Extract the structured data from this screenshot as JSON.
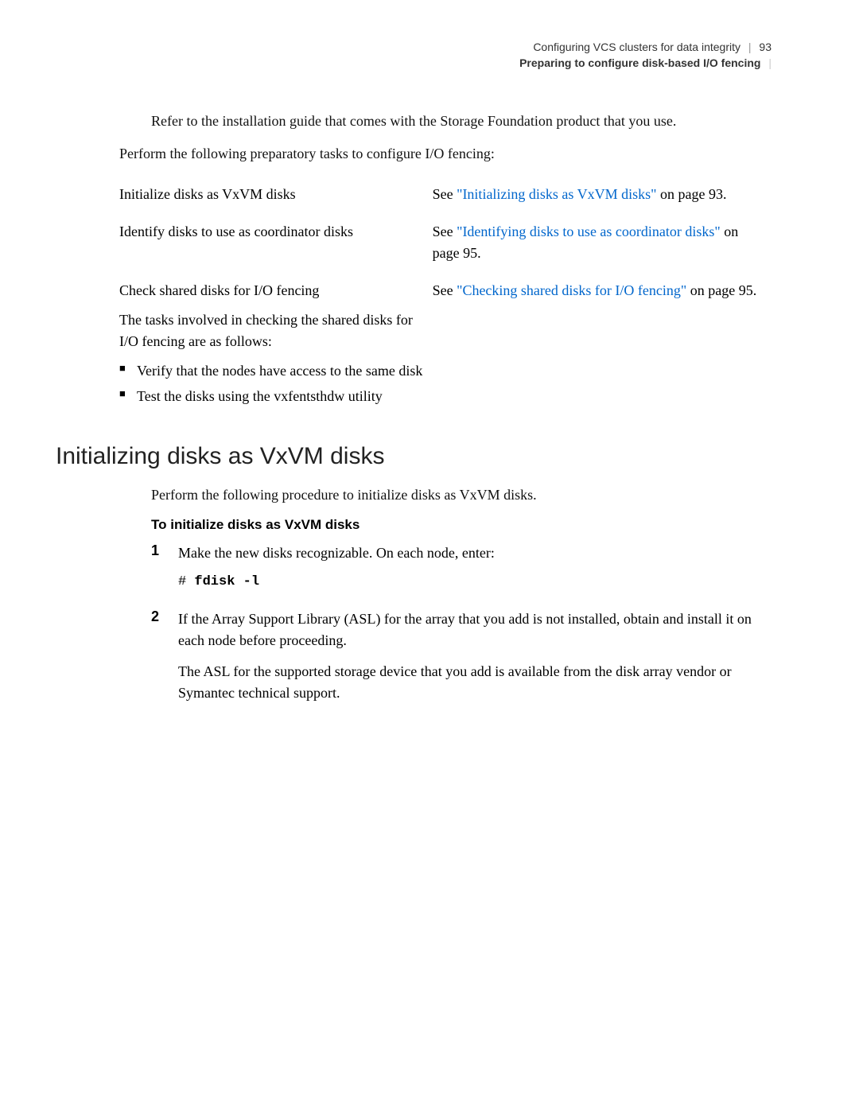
{
  "header": {
    "chapter": "Configuring VCS clusters for data integrity",
    "page_number": "93",
    "section": "Preparing to configure disk-based I/O fencing"
  },
  "intro": {
    "para1": "Refer to the installation guide that comes with the Storage Foundation product that you use.",
    "para2": "Perform the following preparatory tasks to configure I/O fencing:"
  },
  "prep_table": {
    "rows": [
      {
        "left": "Initialize disks as VxVM disks",
        "right_prefix": "See ",
        "right_link": "\"Initializing disks as VxVM disks\"",
        "right_suffix": " on page 93."
      },
      {
        "left": "Identify disks to use as coordinator disks",
        "right_prefix": "See ",
        "right_link": "\"Identifying disks to use as coordinator disks\"",
        "right_suffix": " on page 95."
      },
      {
        "left_main": "Check shared disks for I/O fencing",
        "left_sub": "The tasks involved in checking the shared disks for I/O fencing are as follows:",
        "bullets": [
          "Verify that the nodes have access to the same disk",
          "Test the disks using the vxfentsthdw utility"
        ],
        "right_prefix": "See ",
        "right_link": "\"Checking shared disks for I/O fencing\"",
        "right_suffix": " on page 95."
      }
    ]
  },
  "section": {
    "heading": "Initializing disks as VxVM disks",
    "intro": "Perform the following procedure to initialize disks as VxVM disks.",
    "proc_heading": "To initialize disks as VxVM disks",
    "steps": [
      {
        "num": "1",
        "text": "Make the new disks recognizable. On each node, enter:",
        "code_prompt": "# ",
        "code_cmd": "fdisk -l"
      },
      {
        "num": "2",
        "text": "If the Array Support Library (ASL) for the array that you add is not installed, obtain and install it on each node before proceeding.",
        "sub": "The ASL for the supported storage device that you add is available from the disk array vendor or Symantec technical support."
      }
    ]
  }
}
